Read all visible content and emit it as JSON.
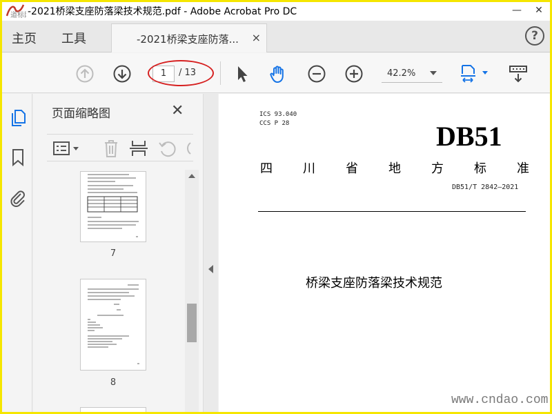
{
  "window": {
    "title": "-2021桥梁支座防落梁技术规范.pdf - Adobe Acrobat Pro DC",
    "logo_text": "道标网",
    "controls": {
      "minimize": "—",
      "close": "✕"
    }
  },
  "tabs": {
    "home_label": "主页",
    "tools_label": "工具",
    "document_label": "-2021桥梁支座防落...",
    "close_glyph": "×",
    "help_glyph": "?"
  },
  "toolbar": {
    "current_page": "1",
    "total_pages": "/ 13",
    "zoom": "42.2%",
    "highlight_color": "#d62020",
    "accent_color": "#1473e6"
  },
  "thumbnails_panel": {
    "title": "页面缩略图",
    "close_glyph": "✕",
    "pages": [
      {
        "number": "7"
      },
      {
        "number": "8"
      }
    ]
  },
  "document": {
    "classification_lines": [
      "ICS 93.040",
      "CCS P 28"
    ],
    "standard_code": "DB51",
    "province_chars": [
      "四",
      "川",
      "省",
      "地",
      "方",
      "标",
      "准"
    ],
    "standard_number": "DB51/T 2842—2021",
    "title": "桥梁支座防落梁技术规范"
  },
  "watermark": "www.cndao.com",
  "icons": [
    "up-arrow-icon",
    "down-arrow-icon",
    "pointer-icon",
    "hand-icon",
    "zoom-out-icon",
    "zoom-in-icon",
    "fit-page-icon",
    "scroll-mode-icon",
    "pages-icon",
    "bookmark-icon",
    "attachment-icon",
    "options-icon",
    "trash-icon",
    "insert-icon",
    "undo-icon"
  ]
}
